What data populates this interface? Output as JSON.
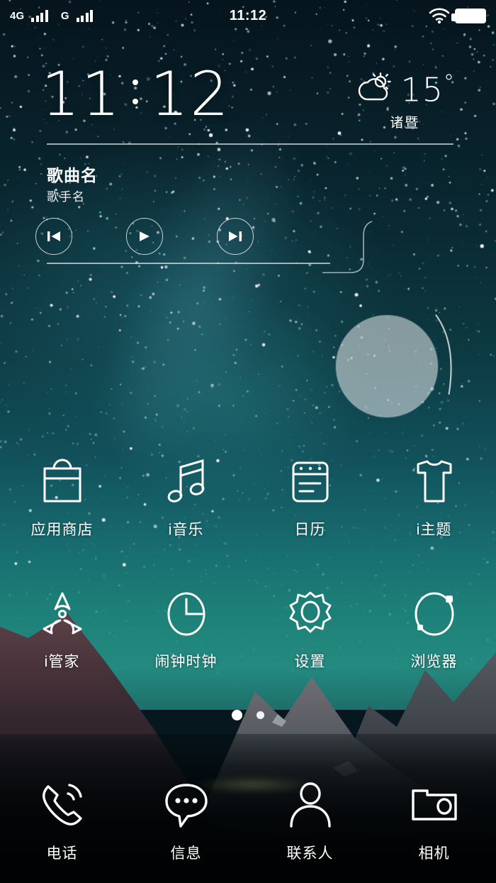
{
  "status_bar": {
    "sim1_network": "4G",
    "sim1_signal_bars": 4,
    "sim2_network": "G",
    "sim2_signal_bars": 4,
    "time": "11:12",
    "wifi_icon": "wifi-icon",
    "battery_icon": "battery-full-icon",
    "battery_level": "100"
  },
  "clock_widget": {
    "hours": "11",
    "minutes": "12",
    "separator_icon": "colon-dots"
  },
  "weather_widget": {
    "icon": "sun-behind-cloud-icon",
    "temperature": "15",
    "degree": "°",
    "city": "诸暨"
  },
  "music_widget": {
    "song_title": "歌曲名",
    "artist": "歌手名",
    "previous_icon": "skip-previous-icon",
    "play_icon": "play-icon",
    "next_icon": "skip-next-icon",
    "album_art_icon": "album-art-circle"
  },
  "app_grid": {
    "rows": [
      [
        {
          "label": "应用商店",
          "icon": "shopping-bag-icon"
        },
        {
          "label": "i音乐",
          "icon": "music-note-icon"
        },
        {
          "label": "日历",
          "icon": "calendar-icon"
        },
        {
          "label": "i主题",
          "icon": "tshirt-icon"
        }
      ],
      [
        {
          "label": "i管家",
          "icon": "radiation-fan-icon"
        },
        {
          "label": "闹钟时钟",
          "icon": "clock-icon"
        },
        {
          "label": "设置",
          "icon": "gear-icon"
        },
        {
          "label": "浏览器",
          "icon": "browser-orbit-icon"
        }
      ]
    ]
  },
  "page_indicator": {
    "total_pages": 2,
    "current_page": 1
  },
  "dock": {
    "items": [
      {
        "label": "电话",
        "icon": "phone-icon"
      },
      {
        "label": "信息",
        "icon": "message-bubble-icon"
      },
      {
        "label": "联系人",
        "icon": "person-icon"
      },
      {
        "label": "相机",
        "icon": "camera-icon"
      }
    ]
  },
  "theme": {
    "icon_color": "#ffffff",
    "text_color": "#ffffff",
    "sky_top": "#06141d",
    "sky_bottom": "#248a80"
  }
}
